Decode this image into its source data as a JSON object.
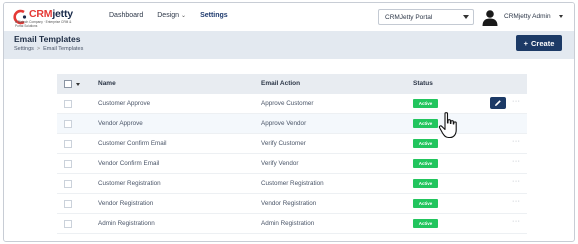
{
  "app": {
    "logo_text_red": "CRM",
    "logo_text_dark": "jetty",
    "logo_tagline": "A Biztech Company · Enterprise CRM & Portal Solutions"
  },
  "nav": {
    "items": [
      {
        "label": "Dashboard",
        "active": false,
        "has_dropdown": false
      },
      {
        "label": "Design",
        "active": false,
        "has_dropdown": true
      },
      {
        "label": "Settings",
        "active": true,
        "has_dropdown": false
      }
    ]
  },
  "portal_select": {
    "value": "CRMJetty Portal"
  },
  "user": {
    "name": "CRMjetty Admin"
  },
  "header": {
    "title": "Email Templates",
    "breadcrumb": [
      "Settings",
      "Email Templates"
    ],
    "breadcrumb_sep": ">",
    "create_label": "Create",
    "create_icon": "+"
  },
  "table": {
    "columns": [
      "Name",
      "Email Action",
      "Status"
    ],
    "rows": [
      {
        "name": "Customer Approve",
        "action": "Approve Customer",
        "status": "Active"
      },
      {
        "name": "Vendor Approve",
        "action": "Approve Vendor",
        "status": "Active"
      },
      {
        "name": "Customer Confirm Email",
        "action": "Verify Customer",
        "status": "Active"
      },
      {
        "name": "Vendor Confirm Email",
        "action": "Verify Vendor",
        "status": "Active"
      },
      {
        "name": "Customer Registration",
        "action": "Customer Registration",
        "status": "Active"
      },
      {
        "name": "Vendor Registration",
        "action": "Vendor Registration",
        "status": "Active"
      },
      {
        "name": "Admin Registrationn",
        "action": "Admin Registration",
        "status": "Active"
      }
    ],
    "more_glyph": "···"
  },
  "colors": {
    "brand_navy": "#1c3a66",
    "brand_red": "#e53935",
    "status_active": "#22c55e",
    "header_band": "#e3e9f0",
    "table_head": "#e8ecf1"
  },
  "icons": {
    "edit": "pencil-icon",
    "cursor": "hand-pointer-icon",
    "avatar": "user-silhouette-icon"
  }
}
